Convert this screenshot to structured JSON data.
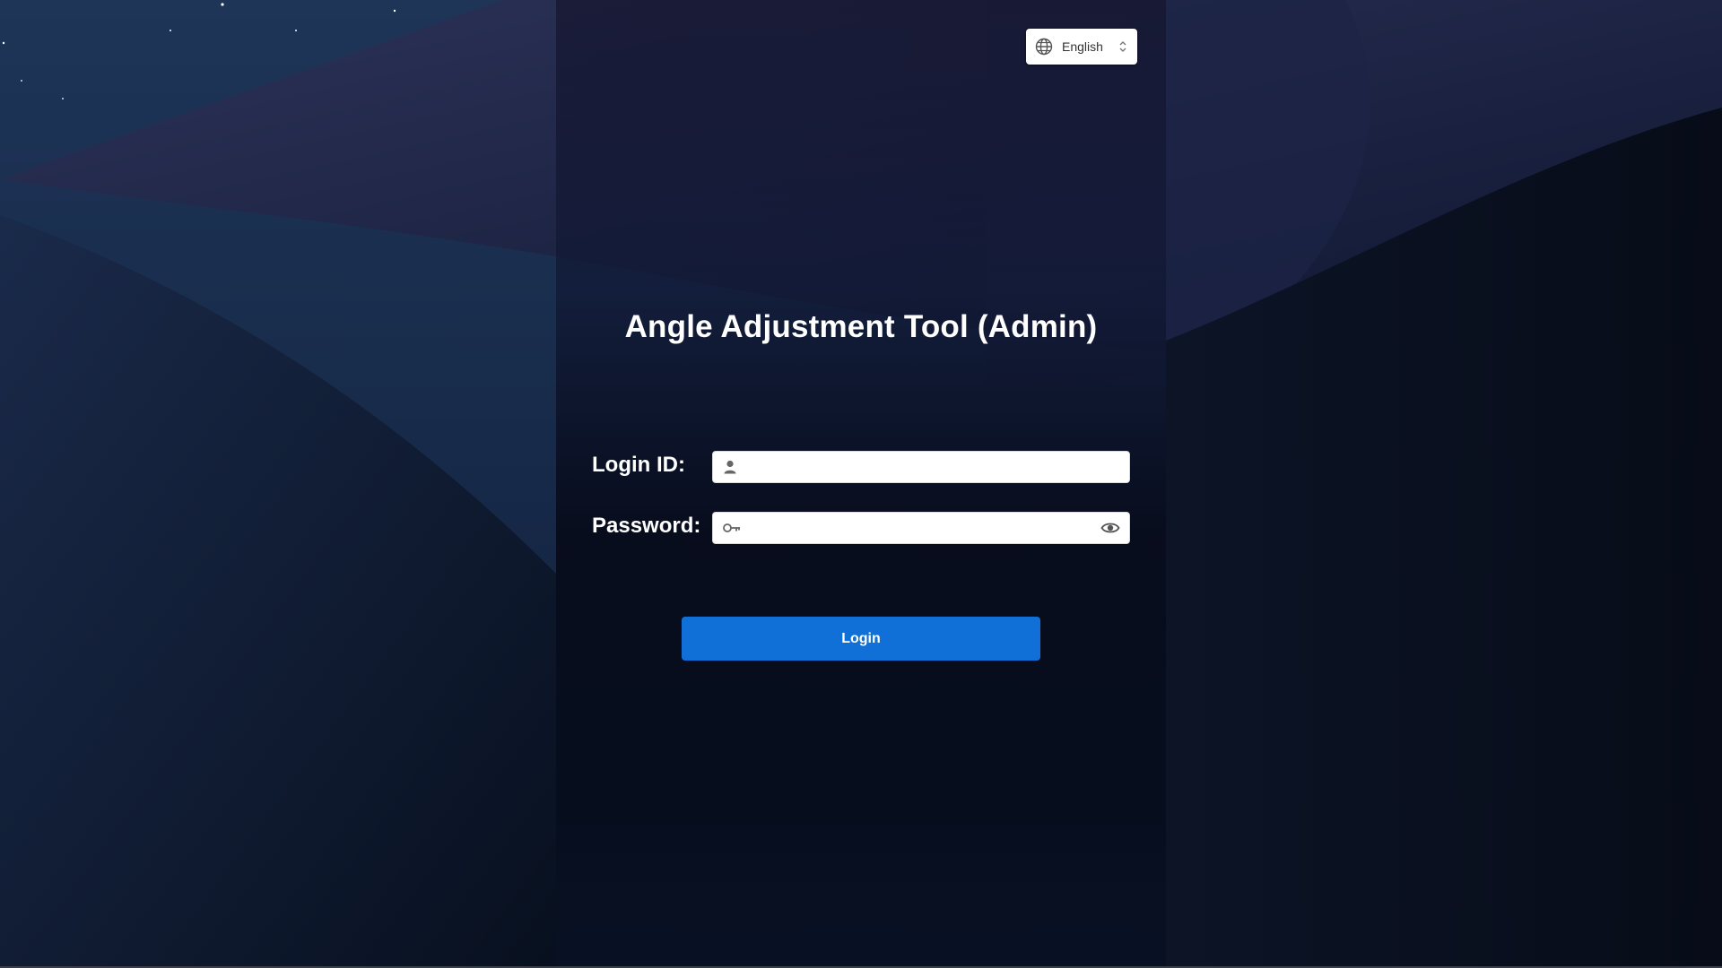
{
  "language_selector": {
    "value": "English",
    "globe_icon": "globe-icon",
    "updown_icon": "chevron-updown-icon"
  },
  "title": "Angle Adjustment Tool (Admin)",
  "form": {
    "login_id_label": "Login ID:",
    "login_id_value": "",
    "login_id_icon": "user-icon",
    "password_label": "Password:",
    "password_value": "",
    "password_icon": "key-icon",
    "password_toggle_icon": "eye-icon"
  },
  "login_button": {
    "label": "Login"
  },
  "colors": {
    "accent": "#1070d8",
    "title_text": "#ffffff",
    "background": "#0b1120"
  }
}
